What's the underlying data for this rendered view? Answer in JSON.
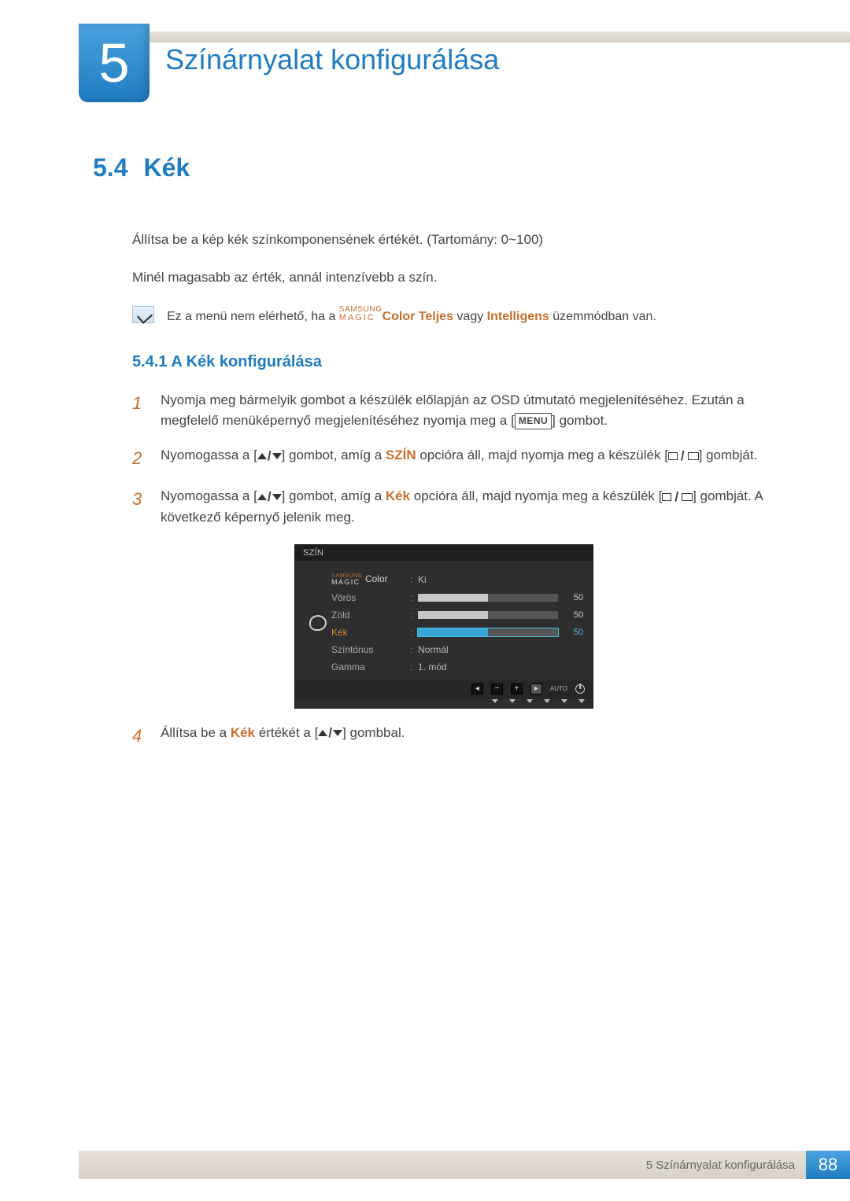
{
  "chapter": {
    "number": "5",
    "title": "Színárnyalat konfigurálása"
  },
  "section": {
    "number": "5.4",
    "title": "Kék"
  },
  "intro": [
    "Állítsa be a kép kék színkomponensének értékét. (Tartomány: 0~100)",
    "Minél magasabb az érték, annál intenzívebb a szín."
  ],
  "note": {
    "pre": "Ez a menü nem elérhető, ha a ",
    "magic_top": "SAMSUNG",
    "magic_bottom": "MAGIC",
    "color_word": "Color",
    "hl1": "Teljes",
    "mid": " vagy ",
    "hl2": "Intelligens",
    "post": " üzemmódban van."
  },
  "subsection": {
    "number": "5.4.1",
    "title": "A Kék konfigurálása"
  },
  "steps": {
    "1": {
      "a": "Nyomja meg bármelyik gombot a készülék előlapján az OSD útmutató megjelenítéséhez. Ezután a megfelelő menüképernyő megjelenítéséhez nyomja meg a [",
      "menu": "MENU",
      "b": "] gombot."
    },
    "2": {
      "a": "Nyomogassa a [",
      "b": "] gombot, amíg a ",
      "hl": "SZÍN",
      "c": " opcióra áll, majd nyomja meg a készülék [",
      "d": "] gombját."
    },
    "3": {
      "a": "Nyomogassa a [",
      "b": "] gombot, amíg a ",
      "hl": "Kék",
      "c": " opcióra áll, majd nyomja meg a készülék [",
      "d": "] gombját. A következő képernyő jelenik meg."
    },
    "4": {
      "a": "Állítsa be a ",
      "hl": "Kék",
      "b": " értékét a [",
      "c": "] gombbal."
    }
  },
  "osd": {
    "title": "SZÍN",
    "rows": {
      "magic": {
        "top": "SAMSUNG",
        "bottom": "MAGIC",
        "color": "Color",
        "val": "Ki"
      },
      "voros": {
        "label": "Vörös",
        "val": "50"
      },
      "zold": {
        "label": "Zöld",
        "val": "50"
      },
      "kek": {
        "label": "Kék",
        "val": "50"
      },
      "szintonus": {
        "label": "Színtónus",
        "val": "Normál"
      },
      "gamma": {
        "label": "Gamma",
        "val": "1. mód"
      }
    },
    "auto": "AUTO"
  },
  "footer": {
    "label": "5 Színárnyalat konfigurálása",
    "page": "88"
  },
  "chart_data": {
    "type": "table",
    "title": "SZÍN OSD menu sliders",
    "rows": [
      {
        "name": "SAMSUNG MAGIC Color",
        "value": "Ki"
      },
      {
        "name": "Vörös",
        "value": 50,
        "range": [
          0,
          100
        ]
      },
      {
        "name": "Zöld",
        "value": 50,
        "range": [
          0,
          100
        ]
      },
      {
        "name": "Kék",
        "value": 50,
        "range": [
          0,
          100
        ],
        "selected": true
      },
      {
        "name": "Színtónus",
        "value": "Normál"
      },
      {
        "name": "Gamma",
        "value": "1. mód"
      }
    ]
  }
}
